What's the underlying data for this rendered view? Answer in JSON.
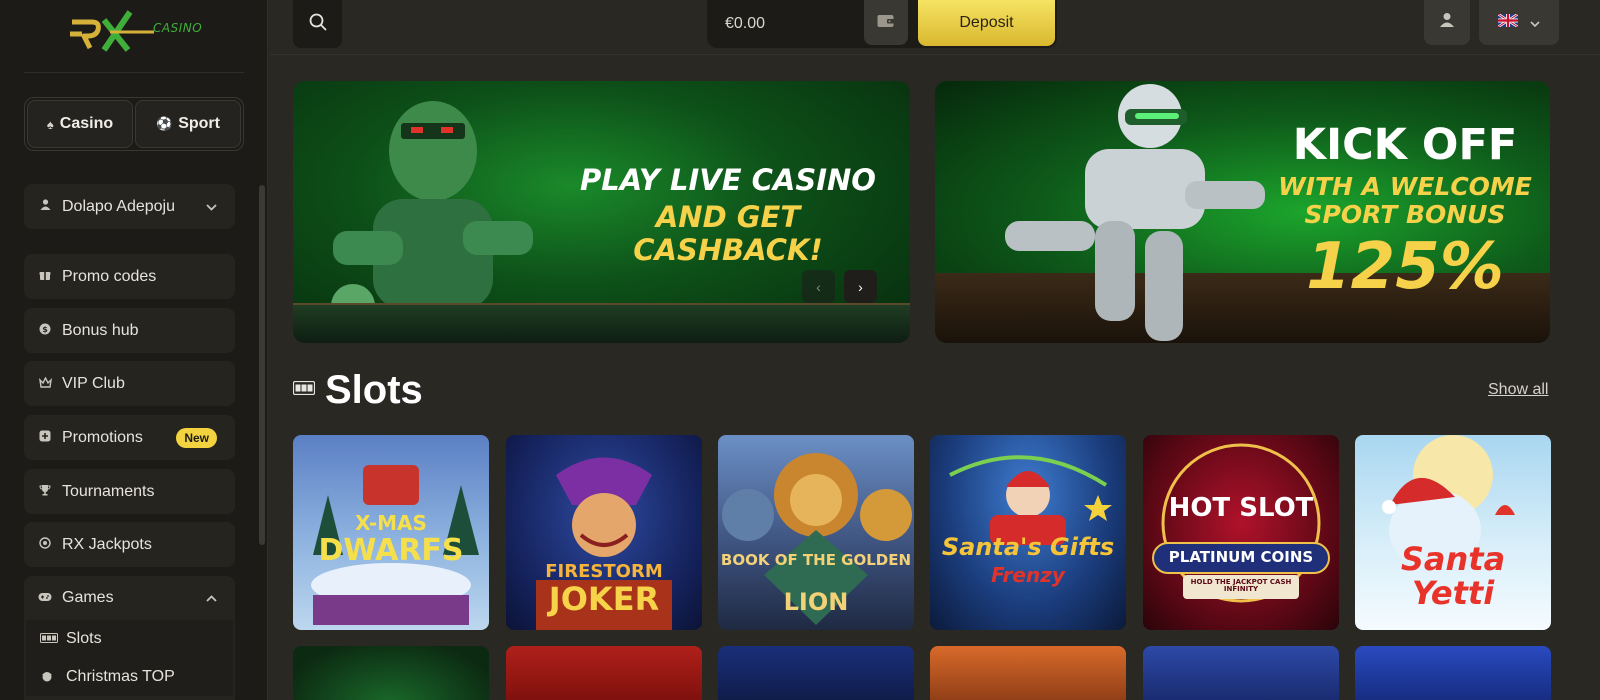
{
  "brand": {
    "logo_text": "RX",
    "logo_sub": "CASINO"
  },
  "sidebar": {
    "modes": [
      {
        "label": "Casino",
        "icon": "spade-icon"
      },
      {
        "label": "Sport",
        "icon": "ball-icon"
      }
    ],
    "user": {
      "name": "Dolapo Adepoju"
    },
    "items": [
      {
        "label": "Promo codes",
        "icon": "gift-icon"
      },
      {
        "label": "Bonus hub",
        "icon": "dollar-circle-icon"
      },
      {
        "label": "VIP Club",
        "icon": "crown-icon"
      },
      {
        "label": "Promotions",
        "icon": "promo-icon",
        "badge": "New"
      },
      {
        "label": "Tournaments",
        "icon": "trophy-icon"
      },
      {
        "label": "RX Jackpots",
        "icon": "jackpot-icon"
      }
    ],
    "games": {
      "label": "Games",
      "children": [
        {
          "label": "Slots",
          "icon": "slot-machine-icon"
        },
        {
          "label": "Christmas TOP",
          "icon": "santa-icon"
        }
      ]
    }
  },
  "topbar": {
    "balance": "€0.00",
    "deposit_label": "Deposit",
    "language": "gb-flag-icon"
  },
  "banners": [
    {
      "line1": "PLAY LIVE CASINO",
      "line2": "AND GET CASHBACK!"
    },
    {
      "line1": "KICK OFF",
      "line2": "WITH A WELCOME",
      "line3": "SPORT BONUS",
      "line4": "125%"
    }
  ],
  "slots": {
    "title": "Slots",
    "show_all": "Show all",
    "games": [
      {
        "name_line1": "X-MAS",
        "name_line2": "DWARFS"
      },
      {
        "name_line1": "FIRESTORM",
        "name_line2": "JOKER"
      },
      {
        "name_line1": "BOOK OF THE GOLDEN",
        "name_line2": "LION"
      },
      {
        "name_line1": "Santa's Gifts",
        "name_line2": "Frenzy"
      },
      {
        "name_line1": "HOT SLOT",
        "name_line2": "PLATINUM COINS",
        "name_line3": "HOLD THE JACKPOT CASH INFINITY"
      },
      {
        "name_line1": "Santa Yetti",
        "name_line2": ""
      }
    ]
  },
  "colors": {
    "accent": "#f2d33f",
    "brand_green": "#3fae3a",
    "background": "#2a2823",
    "sidebar": "#1c1b18"
  }
}
